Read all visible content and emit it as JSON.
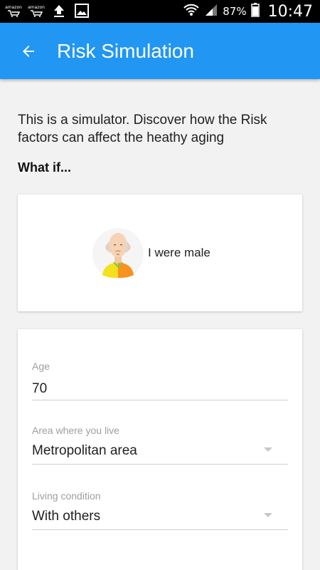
{
  "status_bar": {
    "left_icons": [
      "amazon-icon",
      "amazon-icon",
      "upload-icon",
      "image-icon"
    ],
    "amazon_wordmark": "amazon",
    "battery_percent": "87%",
    "time": "10:47"
  },
  "app_bar": {
    "title": "Risk Simulation",
    "color": "#2196f3"
  },
  "intro": {
    "text": "This is a simulator. Discover how the Risk factors can affect the heathy aging",
    "what_if": "What if..."
  },
  "gender_card": {
    "label": "I were male"
  },
  "form": {
    "age": {
      "label": "Age",
      "value": "70"
    },
    "area": {
      "label": "Area where you live",
      "value": "Metropolitan area"
    },
    "living": {
      "label": "Living condition",
      "value": "With others"
    }
  }
}
